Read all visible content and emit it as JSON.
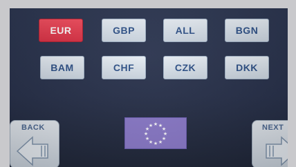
{
  "currencies": [
    {
      "code": "EUR",
      "selected": true
    },
    {
      "code": "GBP",
      "selected": false
    },
    {
      "code": "ALL",
      "selected": false
    },
    {
      "code": "BGN",
      "selected": false
    },
    {
      "code": "BAM",
      "selected": false
    },
    {
      "code": "CHF",
      "selected": false
    },
    {
      "code": "CZK",
      "selected": false
    },
    {
      "code": "DKK",
      "selected": false
    }
  ],
  "nav": {
    "back_label": "BACK",
    "next_label": "NEXT"
  },
  "flag": {
    "icon": "eu-flag-icon",
    "color": "#8a79c9",
    "star_color": "#ffffff"
  },
  "colors": {
    "selected": "#e43a4e",
    "button_text": "#2c4f86",
    "screen_bg": "#2b3550"
  }
}
